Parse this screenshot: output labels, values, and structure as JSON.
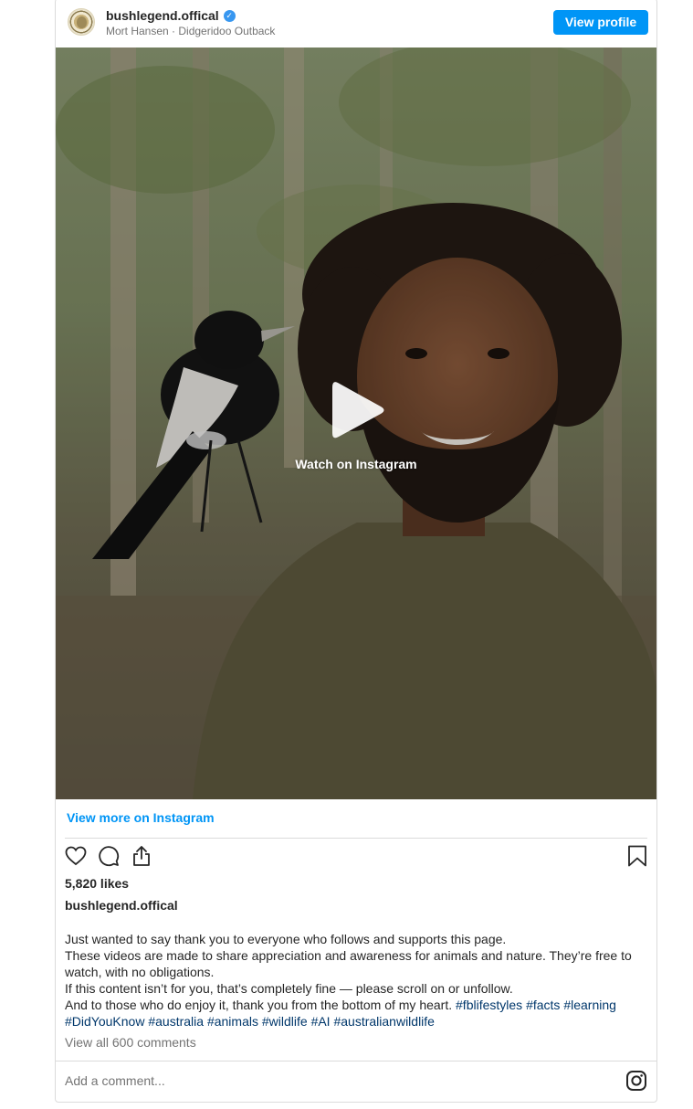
{
  "header": {
    "username": "bushlegend.offical",
    "verified_mark": "✓",
    "subline": "Mort Hansen · Didgeridoo Outback",
    "view_profile_label": "View profile"
  },
  "media": {
    "watch_label": "Watch on Instagram",
    "overlay_icon": "play-icon"
  },
  "links": {
    "view_more": "View more on Instagram"
  },
  "actions": {
    "like_icon": "heart-icon",
    "comment_icon": "comment-icon",
    "share_icon": "share-icon",
    "save_icon": "bookmark-icon"
  },
  "post": {
    "likes": "5,820 likes",
    "caption_user": "bushlegend.offical",
    "caption_lines": [
      "Just wanted to say thank you to everyone who follows and supports this page.",
      "These videos are made to share appreciation and awareness for animals and nature. They’re free to watch, with no obligations.",
      "If this content isn’t for you, that’s completely fine — please scroll on or unfollow.",
      "And to those who do enjoy it, thank you from the bottom of my heart."
    ],
    "hashtags": [
      "#fblifestyles",
      "#facts",
      "#learning",
      "#DidYouKnow",
      "#australia",
      "#animals",
      "#wildlife",
      "#AI",
      "#australianwildlife"
    ],
    "view_all_comments": "View all 600 comments",
    "add_comment_placeholder": "Add a comment...",
    "footer_icon": "instagram-icon"
  },
  "colors": {
    "accent": "#0095f6",
    "hashtag": "#00376b",
    "verified": "#3897f0",
    "muted": "#737373",
    "border": "#dbdbdb"
  }
}
